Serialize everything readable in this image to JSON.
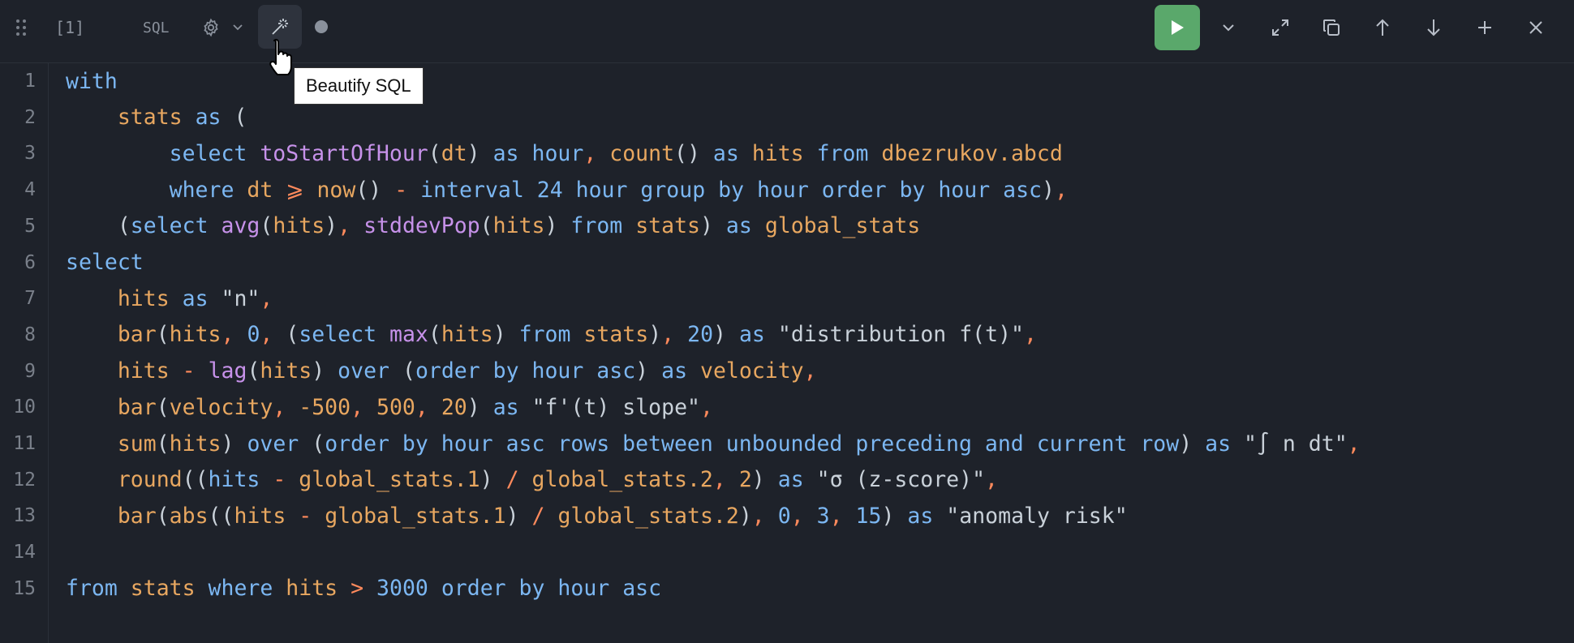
{
  "toolbar": {
    "cell_number": "[1]",
    "language": "SQL",
    "tooltip": "Beautify SQL",
    "icons": [
      "drag-handle-icon",
      "gear-icon",
      "chevron-down-icon",
      "magic-wand-icon",
      "status-dot-icon",
      "play-icon",
      "chevron-down-icon",
      "expand-icon",
      "duplicate-icon",
      "arrow-up-icon",
      "arrow-down-icon",
      "plus-icon",
      "close-icon"
    ],
    "run_color": "#5aa86b"
  },
  "editor": {
    "lines": [
      {
        "n": "1",
        "tokens": [
          [
            "kw",
            "with"
          ]
        ]
      },
      {
        "n": "2",
        "tokens": [
          [
            "ws",
            "    "
          ],
          [
            "id",
            "stats"
          ],
          [
            "ws",
            " "
          ],
          [
            "kw",
            "as"
          ],
          [
            "ws",
            " "
          ],
          [
            "pu",
            "("
          ]
        ]
      },
      {
        "n": "3",
        "tokens": [
          [
            "ws",
            "        "
          ],
          [
            "kw",
            "select"
          ],
          [
            "ws",
            " "
          ],
          [
            "fn",
            "toStartOfHour"
          ],
          [
            "pu",
            "("
          ],
          [
            "id",
            "dt"
          ],
          [
            "pu",
            ")"
          ],
          [
            "ws",
            " "
          ],
          [
            "kw",
            "as"
          ],
          [
            "ws",
            " "
          ],
          [
            "kw",
            "hour"
          ],
          [
            "op",
            ","
          ],
          [
            "ws",
            " "
          ],
          [
            "id",
            "count"
          ],
          [
            "pu",
            "()"
          ],
          [
            "ws",
            " "
          ],
          [
            "kw",
            "as"
          ],
          [
            "ws",
            " "
          ],
          [
            "id",
            "hits"
          ],
          [
            "ws",
            " "
          ],
          [
            "kw",
            "from"
          ],
          [
            "ws",
            " "
          ],
          [
            "id",
            "dbezrukov.abcd"
          ]
        ]
      },
      {
        "n": "4",
        "tokens": [
          [
            "ws",
            "        "
          ],
          [
            "kw",
            "where"
          ],
          [
            "ws",
            " "
          ],
          [
            "id",
            "dt"
          ],
          [
            "ws",
            " "
          ],
          [
            "op",
            "⩾"
          ],
          [
            "ws",
            " "
          ],
          [
            "id",
            "now"
          ],
          [
            "pu",
            "()"
          ],
          [
            "ws",
            " "
          ],
          [
            "op",
            "-"
          ],
          [
            "ws",
            " "
          ],
          [
            "kw",
            "interval 24 hour group by hour order by hour asc"
          ],
          [
            "pu",
            ")"
          ],
          [
            "op",
            ","
          ]
        ]
      },
      {
        "n": "5",
        "tokens": [
          [
            "ws",
            "    "
          ],
          [
            "pu",
            "("
          ],
          [
            "kw",
            "select"
          ],
          [
            "ws",
            " "
          ],
          [
            "fn",
            "avg"
          ],
          [
            "pu",
            "("
          ],
          [
            "id",
            "hits"
          ],
          [
            "pu",
            ")"
          ],
          [
            "op",
            ","
          ],
          [
            "ws",
            " "
          ],
          [
            "fn",
            "stddevPop"
          ],
          [
            "pu",
            "("
          ],
          [
            "id",
            "hits"
          ],
          [
            "pu",
            ")"
          ],
          [
            "ws",
            " "
          ],
          [
            "kw",
            "from"
          ],
          [
            "ws",
            " "
          ],
          [
            "id",
            "stats"
          ],
          [
            "pu",
            ")"
          ],
          [
            "ws",
            " "
          ],
          [
            "kw",
            "as"
          ],
          [
            "ws",
            " "
          ],
          [
            "id",
            "global_stats"
          ]
        ]
      },
      {
        "n": "6",
        "tokens": [
          [
            "kw",
            "select"
          ]
        ]
      },
      {
        "n": "7",
        "tokens": [
          [
            "ws",
            "    "
          ],
          [
            "id",
            "hits"
          ],
          [
            "ws",
            " "
          ],
          [
            "kw",
            "as"
          ],
          [
            "ws",
            " "
          ],
          [
            "st",
            "\"n\""
          ],
          [
            "op",
            ","
          ]
        ]
      },
      {
        "n": "8",
        "tokens": [
          [
            "ws",
            "    "
          ],
          [
            "id",
            "bar"
          ],
          [
            "pu",
            "("
          ],
          [
            "id",
            "hits"
          ],
          [
            "op",
            ","
          ],
          [
            "ws",
            " "
          ],
          [
            "nm",
            "0"
          ],
          [
            "op",
            ","
          ],
          [
            "ws",
            " "
          ],
          [
            "pu",
            "("
          ],
          [
            "kw",
            "select"
          ],
          [
            "ws",
            " "
          ],
          [
            "fn",
            "max"
          ],
          [
            "pu",
            "("
          ],
          [
            "id",
            "hits"
          ],
          [
            "pu",
            ")"
          ],
          [
            "ws",
            " "
          ],
          [
            "kw",
            "from"
          ],
          [
            "ws",
            " "
          ],
          [
            "id",
            "stats"
          ],
          [
            "pu",
            ")"
          ],
          [
            "op",
            ","
          ],
          [
            "ws",
            " "
          ],
          [
            "nm",
            "20"
          ],
          [
            "pu",
            ")"
          ],
          [
            "ws",
            " "
          ],
          [
            "kw",
            "as"
          ],
          [
            "ws",
            " "
          ],
          [
            "st",
            "\"distribution f(t)\""
          ],
          [
            "op",
            ","
          ]
        ]
      },
      {
        "n": "9",
        "tokens": [
          [
            "ws",
            "    "
          ],
          [
            "id",
            "hits"
          ],
          [
            "ws",
            " "
          ],
          [
            "op",
            "-"
          ],
          [
            "ws",
            " "
          ],
          [
            "fn",
            "lag"
          ],
          [
            "pu",
            "("
          ],
          [
            "id",
            "hits"
          ],
          [
            "pu",
            ")"
          ],
          [
            "ws",
            " "
          ],
          [
            "kw",
            "over"
          ],
          [
            "ws",
            " "
          ],
          [
            "pu",
            "("
          ],
          [
            "kw",
            "order by hour asc"
          ],
          [
            "pu",
            ")"
          ],
          [
            "ws",
            " "
          ],
          [
            "kw",
            "as"
          ],
          [
            "ws",
            " "
          ],
          [
            "id",
            "velocity"
          ],
          [
            "op",
            ","
          ]
        ]
      },
      {
        "n": "10",
        "tokens": [
          [
            "ws",
            "    "
          ],
          [
            "id",
            "bar"
          ],
          [
            "pu",
            "("
          ],
          [
            "id",
            "velocity"
          ],
          [
            "op",
            ","
          ],
          [
            "ws",
            " "
          ],
          [
            "id",
            "-500"
          ],
          [
            "op",
            ","
          ],
          [
            "ws",
            " "
          ],
          [
            "id",
            "500"
          ],
          [
            "op",
            ","
          ],
          [
            "ws",
            " "
          ],
          [
            "id",
            "20"
          ],
          [
            "pu",
            ")"
          ],
          [
            "ws",
            " "
          ],
          [
            "kw",
            "as"
          ],
          [
            "ws",
            " "
          ],
          [
            "st",
            "\"f'(t) slope\""
          ],
          [
            "op",
            ","
          ]
        ]
      },
      {
        "n": "11",
        "tokens": [
          [
            "ws",
            "    "
          ],
          [
            "id",
            "sum"
          ],
          [
            "pu",
            "("
          ],
          [
            "id",
            "hits"
          ],
          [
            "pu",
            ")"
          ],
          [
            "ws",
            " "
          ],
          [
            "kw",
            "over"
          ],
          [
            "ws",
            " "
          ],
          [
            "pu",
            "("
          ],
          [
            "kw",
            "order by hour asc rows between unbounded preceding and current row"
          ],
          [
            "pu",
            ")"
          ],
          [
            "ws",
            " "
          ],
          [
            "kw",
            "as"
          ],
          [
            "ws",
            " "
          ],
          [
            "st",
            "\"∫ n dt\""
          ],
          [
            "op",
            ","
          ]
        ]
      },
      {
        "n": "12",
        "tokens": [
          [
            "ws",
            "    "
          ],
          [
            "id",
            "round"
          ],
          [
            "pu",
            "(("
          ],
          [
            "kw",
            "hits"
          ],
          [
            "ws",
            " "
          ],
          [
            "op",
            "-"
          ],
          [
            "ws",
            " "
          ],
          [
            "id",
            "global_stats.1"
          ],
          [
            "pu",
            ")"
          ],
          [
            "ws",
            " "
          ],
          [
            "op",
            "/"
          ],
          [
            "ws",
            " "
          ],
          [
            "id",
            "global_stats.2"
          ],
          [
            "op",
            ","
          ],
          [
            "ws",
            " "
          ],
          [
            "id",
            "2"
          ],
          [
            "pu",
            ")"
          ],
          [
            "ws",
            " "
          ],
          [
            "kw",
            "as"
          ],
          [
            "ws",
            " "
          ],
          [
            "st",
            "\"σ (z-score)\""
          ],
          [
            "op",
            ","
          ]
        ]
      },
      {
        "n": "13",
        "tokens": [
          [
            "ws",
            "    "
          ],
          [
            "id",
            "bar"
          ],
          [
            "pu",
            "("
          ],
          [
            "id",
            "abs"
          ],
          [
            "pu",
            "(("
          ],
          [
            "id",
            "hits"
          ],
          [
            "ws",
            " "
          ],
          [
            "op",
            "-"
          ],
          [
            "ws",
            " "
          ],
          [
            "id",
            "global_stats.1"
          ],
          [
            "pu",
            ")"
          ],
          [
            "ws",
            " "
          ],
          [
            "op",
            "/"
          ],
          [
            "ws",
            " "
          ],
          [
            "id",
            "global_stats.2"
          ],
          [
            "pu",
            ")"
          ],
          [
            "op",
            ","
          ],
          [
            "ws",
            " "
          ],
          [
            "nm",
            "0"
          ],
          [
            "op",
            ","
          ],
          [
            "ws",
            " "
          ],
          [
            "nm",
            "3"
          ],
          [
            "op",
            ","
          ],
          [
            "ws",
            " "
          ],
          [
            "nm",
            "15"
          ],
          [
            "pu",
            ")"
          ],
          [
            "ws",
            " "
          ],
          [
            "kw",
            "as"
          ],
          [
            "ws",
            " "
          ],
          [
            "st",
            "\"anomaly risk\""
          ]
        ]
      },
      {
        "n": "14",
        "tokens": []
      },
      {
        "n": "15",
        "tokens": [
          [
            "kw",
            "from"
          ],
          [
            "ws",
            " "
          ],
          [
            "id",
            "stats"
          ],
          [
            "ws",
            " "
          ],
          [
            "kw",
            "where"
          ],
          [
            "ws",
            " "
          ],
          [
            "id",
            "hits"
          ],
          [
            "ws",
            " "
          ],
          [
            "op",
            ">"
          ],
          [
            "ws",
            " "
          ],
          [
            "nm",
            "3000"
          ],
          [
            "ws",
            " "
          ],
          [
            "kw",
            "order by hour asc"
          ]
        ]
      }
    ]
  }
}
